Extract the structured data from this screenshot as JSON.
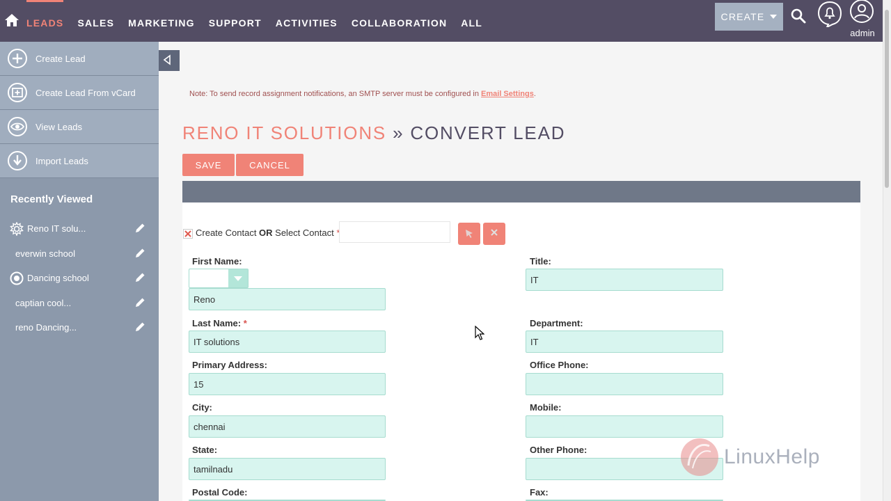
{
  "nav": {
    "items": [
      "LEADS",
      "SALES",
      "MARKETING",
      "SUPPORT",
      "ACTIVITIES",
      "COLLABORATION",
      "ALL"
    ],
    "create_label": "CREATE",
    "user": "admin"
  },
  "sidebar": {
    "actions": [
      "Create Lead",
      "Create Lead From vCard",
      "View Leads",
      "Import Leads"
    ],
    "recent_title": "Recently Viewed",
    "recent": [
      "Reno IT solu...",
      "everwin school",
      "Dancing school",
      "captian cool...",
      "reno Dancing..."
    ]
  },
  "note": {
    "text": "Note: To send record assignment notifications, an SMTP server must be configured in ",
    "link": "Email Settings",
    "suffix": "."
  },
  "title": {
    "record": "RENO IT SOLUTIONS",
    "separator": " » ",
    "action": "CONVERT LEAD"
  },
  "buttons": {
    "save": "SAVE",
    "cancel": "CANCEL"
  },
  "contact": {
    "create": "Create Contact ",
    "or": "OR",
    "select": " Select Contact ",
    "required": "*"
  },
  "form": {
    "first_name": {
      "label": "First Name:",
      "value": "Reno"
    },
    "last_name": {
      "label": "Last Name:",
      "value": "IT solutions"
    },
    "primary_address": {
      "label": "Primary Address:",
      "value": "15"
    },
    "city": {
      "label": "City:",
      "value": "chennai"
    },
    "state": {
      "label": "State:",
      "value": "tamilnadu"
    },
    "postal_code": {
      "label": "Postal Code:",
      "value": ""
    },
    "title": {
      "label": "Title:",
      "value": "IT"
    },
    "department": {
      "label": "Department:",
      "value": "IT"
    },
    "office_phone": {
      "label": "Office Phone:",
      "value": ""
    },
    "mobile": {
      "label": "Mobile:",
      "value": ""
    },
    "other_phone": {
      "label": "Other Phone:",
      "value": ""
    },
    "fax": {
      "label": "Fax:",
      "value": ""
    },
    "required_mark": "*"
  },
  "watermark": "LinuxHelp",
  "colors": {
    "accent": "#f08377",
    "nav_bg": "#534d64",
    "sidebar_bg": "#8c99ab",
    "field_bg": "#d8f5ef"
  }
}
